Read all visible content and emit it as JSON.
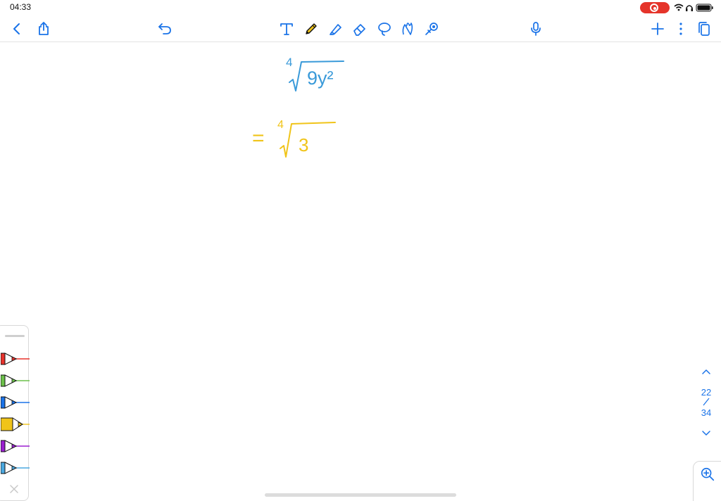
{
  "status_bar": {
    "time": "04:33",
    "icons": [
      "recording-indicator",
      "wifi-icon",
      "headphones-icon",
      "battery-icon"
    ]
  },
  "toolbar": {
    "left": [
      "back-icon",
      "share-icon",
      "undo-icon"
    ],
    "tools": [
      "text-tool-icon",
      "pen-icon",
      "highlighter-icon",
      "eraser-icon",
      "lasso-icon",
      "shape-icon",
      "laser-pointer-icon"
    ],
    "right": [
      "microphone-icon",
      "add-icon",
      "more-icon",
      "pages-icon"
    ]
  },
  "canvas": {
    "ink": [
      {
        "text": "4",
        "color": "#3a9ad9"
      },
      {
        "text": "9y²",
        "color": "#3a9ad9"
      },
      {
        "text": "=",
        "color": "#f0c419"
      },
      {
        "text": "4",
        "color": "#f0c419"
      },
      {
        "text": "3",
        "color": "#f0c419"
      }
    ]
  },
  "pen_palette": {
    "pens": [
      {
        "name": "red",
        "color": "#e8322c"
      },
      {
        "name": "green",
        "color": "#6cc04a"
      },
      {
        "name": "blue",
        "color": "#1a73e8"
      },
      {
        "name": "yellow",
        "color": "#f0c419"
      },
      {
        "name": "purple",
        "color": "#9b1fd1"
      },
      {
        "name": "light-blue",
        "color": "#4aa8e0"
      }
    ]
  },
  "page_nav": {
    "current": "22",
    "total": "34"
  },
  "colors": {
    "accent": "#1a73e8",
    "ink_blue": "#3a9ad9",
    "ink_yellow": "#f0c419"
  }
}
